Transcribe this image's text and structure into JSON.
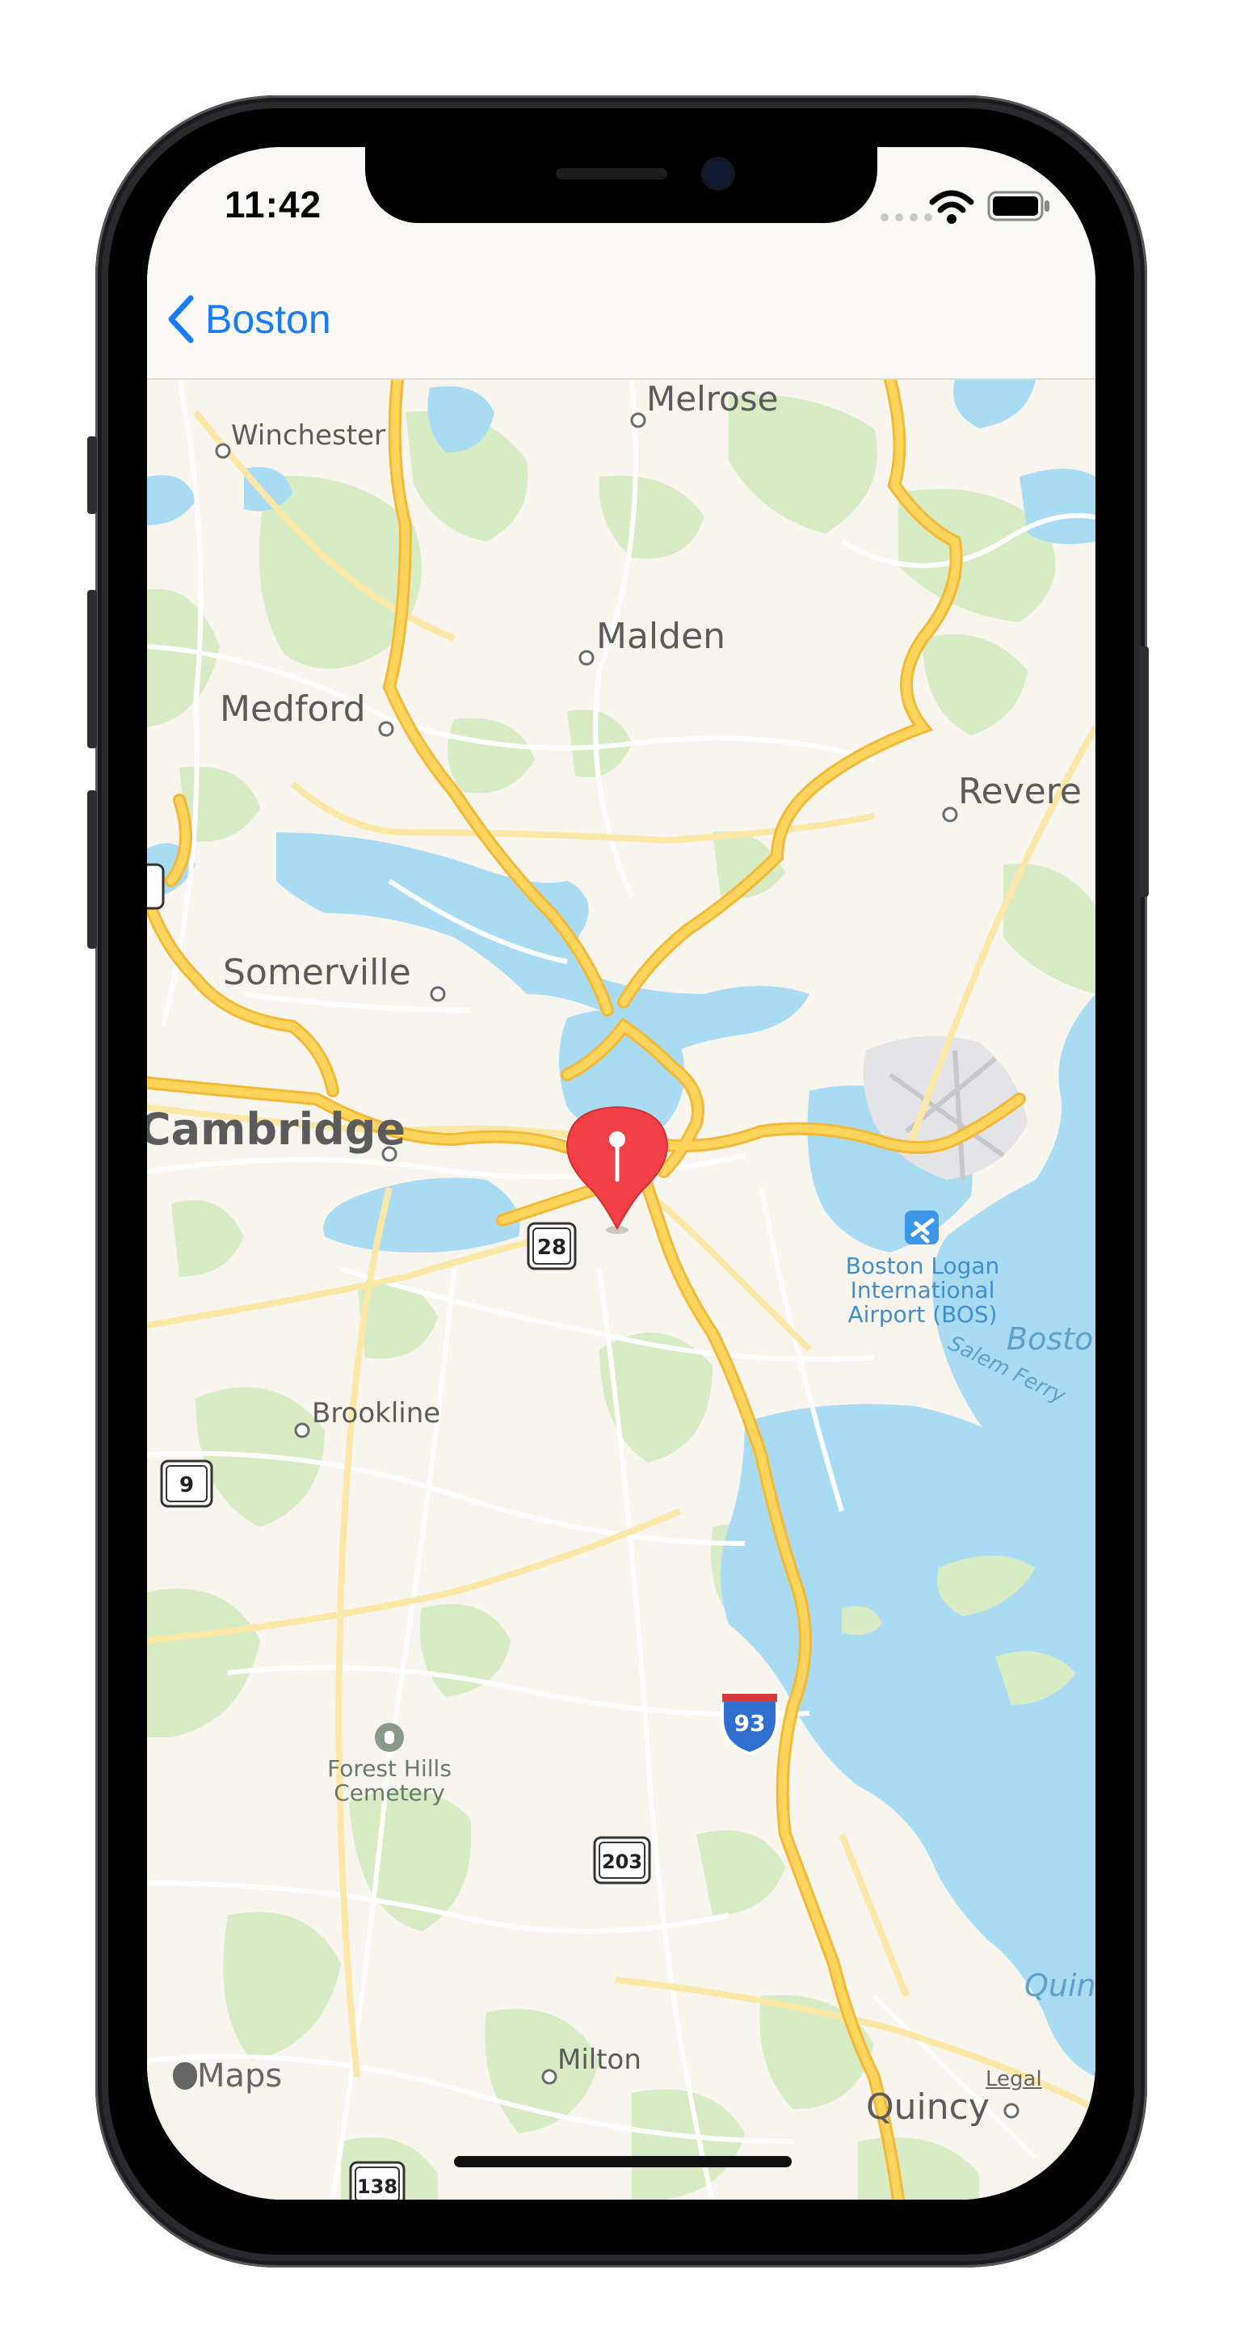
{
  "status_bar": {
    "time": "11:42"
  },
  "nav": {
    "back_label": "Boston"
  },
  "map": {
    "places": {
      "melrose": "Melrose",
      "winchester": "Winchester",
      "malden": "Malden",
      "medford": "Medford",
      "revere": "Revere",
      "somerville": "Somerville",
      "cambridge": "Cambridge",
      "brookline": "Brookline",
      "milton": "Milton",
      "quincy": "Quincy"
    },
    "airport": [
      "Boston Logan",
      "International",
      "Airport (BOS)"
    ],
    "cemetery": [
      "Forest Hills",
      "Cemetery"
    ],
    "water": {
      "harbor": "Bosto",
      "bay": "Quin",
      "ferry": "Salem Ferry"
    },
    "route_shields": {
      "r28": "28",
      "r9": "9",
      "r203": "203",
      "r138": "138",
      "i93": "93"
    },
    "pin_icon": "map-pin-icon",
    "colors": {
      "land": "#f8f5ef",
      "water": "#a9dcf3",
      "park": "#d7ebc5",
      "highway": "#fdd55c",
      "pin": "#f23f45",
      "accent": "#1a7cf5"
    }
  },
  "attribution": {
    "maps": "Maps",
    "legal": "Legal"
  }
}
